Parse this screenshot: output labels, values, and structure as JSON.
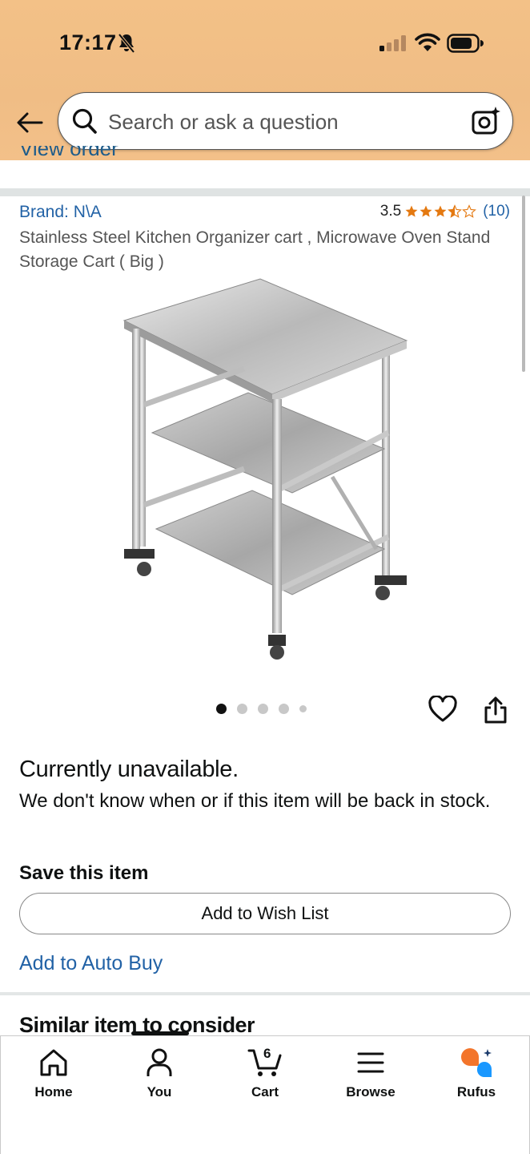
{
  "status_bar": {
    "time": "17:17"
  },
  "search": {
    "placeholder": "Search or ask a question"
  },
  "view_order": "View order",
  "product": {
    "brand": "Brand: N\\A",
    "rating_value": "3.5",
    "rating_stars": 3.5,
    "rating_count": "(10)",
    "title": "Stainless Steel Kitchen Organizer cart , Microwave Oven Stand Storage Cart ( Big )",
    "image_count": 5,
    "active_image": 1
  },
  "availability": {
    "status": "Currently unavailable.",
    "note": "We don't know when or if this item will be back in stock."
  },
  "save_section": {
    "heading": "Save this item",
    "wishlist_button": "Add to Wish List",
    "auto_buy_link": "Add to Auto Buy"
  },
  "similar": {
    "heading": "Similar item to consider"
  },
  "tab_bar": {
    "tabs": [
      {
        "label": "Home",
        "icon": "home-icon"
      },
      {
        "label": "You",
        "icon": "person-icon"
      },
      {
        "label": "Cart",
        "icon": "cart-icon",
        "count": "6"
      },
      {
        "label": "Browse",
        "icon": "menu-icon"
      },
      {
        "label": "Rufus",
        "icon": "rufus-icon"
      }
    ],
    "active": "You"
  },
  "colors": {
    "header_bg": "#f0bd85",
    "link": "#2262a6",
    "star": "#e47911",
    "rufus_orange": "#f3752b",
    "rufus_blue": "#1a98ff"
  }
}
